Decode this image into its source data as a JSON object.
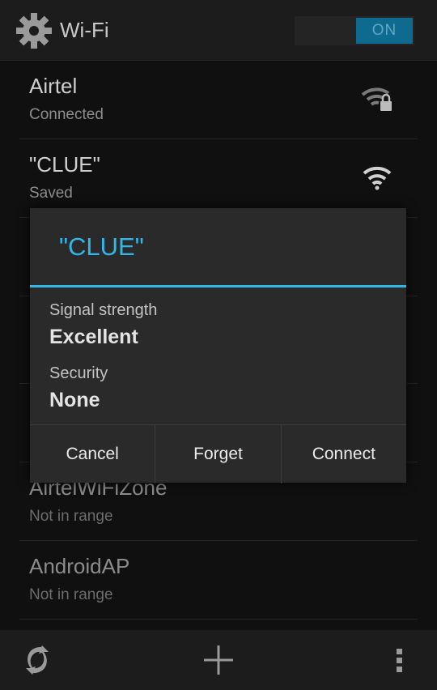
{
  "header": {
    "title": "Wi-Fi",
    "toggle_label": "ON"
  },
  "networks": [
    {
      "name": "Airtel",
      "status": "Connected"
    },
    {
      "name": "\"CLUE\"",
      "status": "Saved"
    },
    {
      "name": "",
      "status": ""
    },
    {
      "name": "",
      "status": ""
    },
    {
      "name": "",
      "status": ""
    },
    {
      "name": "AirtelWiFiZone",
      "status": "Not in range"
    },
    {
      "name": "AndroidAP",
      "status": "Not in range"
    }
  ],
  "dialog": {
    "title": "\"CLUE\"",
    "fields": [
      {
        "label": "Signal strength",
        "value": "Excellent"
      },
      {
        "label": "Security",
        "value": "None"
      }
    ],
    "buttons": {
      "cancel": "Cancel",
      "forget": "Forget",
      "connect": "Connect"
    }
  },
  "colors": {
    "accent": "#33b5e5",
    "toggle_on": "#0e6a8e"
  },
  "icons": {
    "header": "gear-icon",
    "row_0": "wifi-locked-icon",
    "row_1": "wifi-signal-icon",
    "bottom": [
      "wps-icon",
      "add-icon",
      "overflow-menu-icon"
    ]
  }
}
